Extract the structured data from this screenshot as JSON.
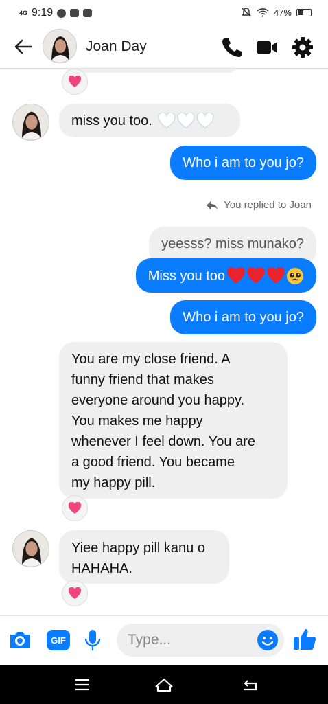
{
  "status_bar": {
    "network": "4G",
    "time": "9:19",
    "battery": "47%",
    "battery_level": 0.47
  },
  "header": {
    "contact_name": "Joan Day"
  },
  "messages": {
    "m1_text": "miss you too.",
    "m2_text": "Who i am to you jo?",
    "replied_note": "You replied to Joan",
    "m3_quote": "yeesss? miss munako?",
    "m3_text": "Miss you too",
    "m4_text": "Who i am to you jo?",
    "m5_lines": [
      "You are my close friend. A",
      "funny friend that makes",
      "everyone around you happy.",
      "You makes me happy",
      "whenever I feel down. You are",
      "a good friend. You became",
      "my happy pill."
    ],
    "m6_lines": [
      "Yiee happy pill kanu o",
      "HAHAHA."
    ]
  },
  "composer": {
    "placeholder": "Type...",
    "gif_label": "GIF"
  },
  "colors": {
    "accent": "#0a7cff",
    "incoming_bubble": "#efefef",
    "reaction_heart": "#f0457a"
  }
}
